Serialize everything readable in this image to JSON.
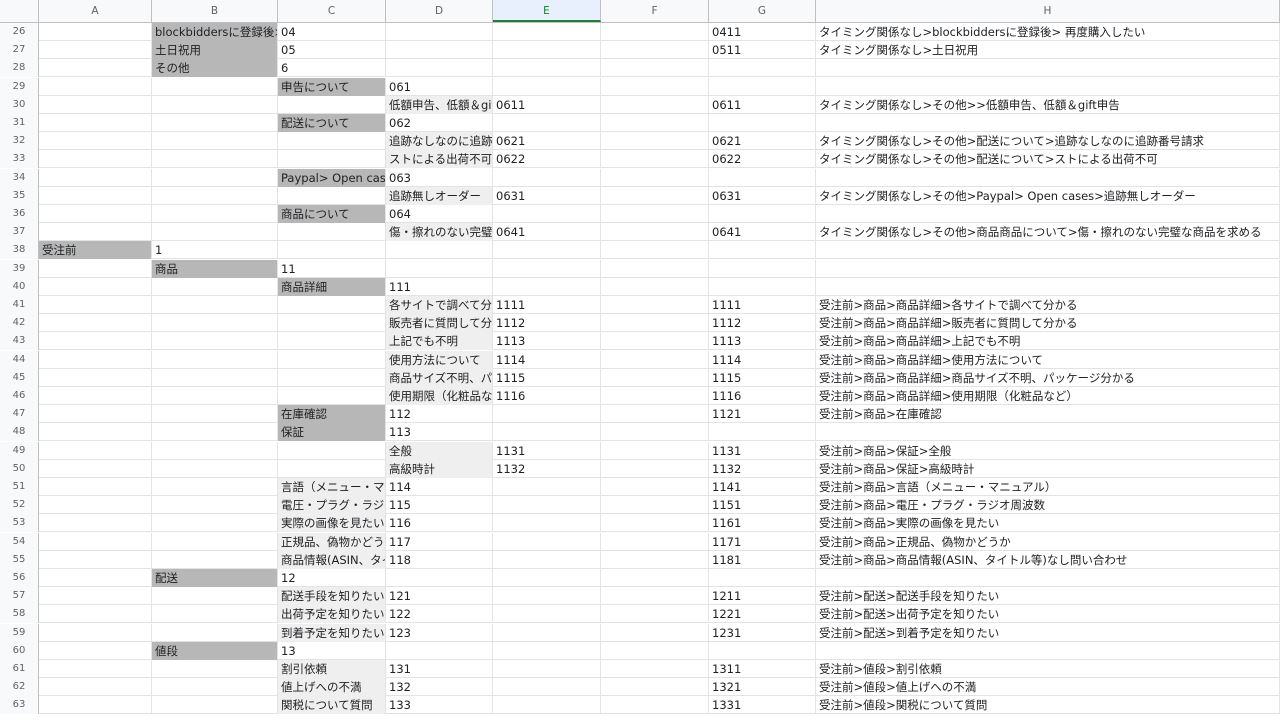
{
  "columns": [
    "A",
    "B",
    "C",
    "D",
    "E",
    "F",
    "G",
    "H"
  ],
  "selected_column": "E",
  "rows": [
    {
      "n": "26",
      "cells": {
        "B": {
          "t": "blockbiddersに登録後>",
          "bg": "gray"
        },
        "C": {
          "t": "04"
        },
        "G": {
          "t": "0411"
        },
        "H": {
          "t": "タイミング関係なし>blockbiddersに登録後> 再度購入したい"
        }
      }
    },
    {
      "n": "27",
      "cells": {
        "B": {
          "t": "土日祝用",
          "bg": "gray"
        },
        "C": {
          "t": "05"
        },
        "G": {
          "t": "0511"
        },
        "H": {
          "t": "タイミング関係なし>土日祝用"
        }
      }
    },
    {
      "n": "28",
      "cells": {
        "B": {
          "t": "その他",
          "bg": "gray"
        },
        "C": {
          "t": "6"
        }
      }
    },
    {
      "n": "29",
      "cells": {
        "C": {
          "t": "申告について",
          "bg": "gray"
        },
        "D": {
          "t": "061"
        }
      }
    },
    {
      "n": "30",
      "cells": {
        "D": {
          "t": "低額申告、低額＆gift",
          "bg": "lightgray"
        },
        "E": {
          "t": "0611"
        },
        "G": {
          "t": "0611"
        },
        "H": {
          "t": "タイミング関係なし>その他>>低額申告、低額＆gift申告"
        }
      }
    },
    {
      "n": "31",
      "cells": {
        "C": {
          "t": "配送について",
          "bg": "gray"
        },
        "D": {
          "t": "062"
        }
      }
    },
    {
      "n": "32",
      "cells": {
        "D": {
          "t": "追跡なしなのに追跡番号請求",
          "bg": "lightgray"
        },
        "E": {
          "t": "0621"
        },
        "G": {
          "t": "0621"
        },
        "H": {
          "t": "タイミング関係なし>その他>配送について>追跡なしなのに追跡番号請求"
        }
      }
    },
    {
      "n": "33",
      "cells": {
        "D": {
          "t": "ストによる出荷不可",
          "bg": "lightgray"
        },
        "E": {
          "t": "0622"
        },
        "G": {
          "t": "0622"
        },
        "H": {
          "t": "タイミング関係なし>その他>配送について>ストによる出荷不可"
        }
      }
    },
    {
      "n": "34",
      "cells": {
        "C": {
          "t": "Paypal> Open cases",
          "bg": "gray"
        },
        "D": {
          "t": "063"
        }
      }
    },
    {
      "n": "35",
      "cells": {
        "D": {
          "t": "追跡無しオーダー",
          "bg": "lightgray"
        },
        "E": {
          "t": "0631"
        },
        "G": {
          "t": "0631"
        },
        "H": {
          "t": "タイミング関係なし>その他>Paypal> Open cases>追跡無しオーダー"
        }
      }
    },
    {
      "n": "36",
      "cells": {
        "C": {
          "t": "商品について",
          "bg": "gray"
        },
        "D": {
          "t": "064"
        }
      }
    },
    {
      "n": "37",
      "cells": {
        "D": {
          "t": "傷・擦れのない完璧な商品を求める",
          "bg": "lightgray"
        },
        "E": {
          "t": "0641"
        },
        "G": {
          "t": "0641"
        },
        "H": {
          "t": "タイミング関係なし>その他>商品商品について>傷・擦れのない完璧な商品を求める"
        }
      }
    },
    {
      "n": "38",
      "cells": {
        "A": {
          "t": "受注前",
          "bg": "gray"
        },
        "B": {
          "t": "1"
        }
      }
    },
    {
      "n": "39",
      "cells": {
        "B": {
          "t": "商品",
          "bg": "gray"
        },
        "C": {
          "t": "11"
        }
      }
    },
    {
      "n": "40",
      "cells": {
        "C": {
          "t": "商品詳細",
          "bg": "gray"
        },
        "D": {
          "t": "111"
        }
      }
    },
    {
      "n": "41",
      "cells": {
        "D": {
          "t": "各サイトで調べて分かる",
          "bg": "lightgray"
        },
        "E": {
          "t": "1111"
        },
        "G": {
          "t": "1111"
        },
        "H": {
          "t": "受注前>商品>商品詳細>各サイトで調べて分かる"
        }
      }
    },
    {
      "n": "42",
      "cells": {
        "D": {
          "t": "販売者に質問して分かる",
          "bg": "lightgray"
        },
        "E": {
          "t": "1112"
        },
        "G": {
          "t": "1112"
        },
        "H": {
          "t": "受注前>商品>商品詳細>販売者に質問して分かる"
        }
      }
    },
    {
      "n": "43",
      "cells": {
        "D": {
          "t": "上記でも不明",
          "bg": "lightgray"
        },
        "E": {
          "t": "1113"
        },
        "G": {
          "t": "1113"
        },
        "H": {
          "t": "受注前>商品>商品詳細>上記でも不明"
        }
      }
    },
    {
      "n": "44",
      "cells": {
        "D": {
          "t": "使用方法について",
          "bg": "lightgray"
        },
        "E": {
          "t": "1114"
        },
        "G": {
          "t": "1114"
        },
        "H": {
          "t": "受注前>商品>商品詳細>使用方法について"
        }
      }
    },
    {
      "n": "45",
      "cells": {
        "D": {
          "t": "商品サイズ不明、パッケージ分かる",
          "bg": "lightgray"
        },
        "E": {
          "t": "1115"
        },
        "G": {
          "t": "1115"
        },
        "H": {
          "t": "受注前>商品>商品詳細>商品サイズ不明、パッケージ分かる"
        }
      }
    },
    {
      "n": "46",
      "cells": {
        "D": {
          "t": "使用期限（化粧品など）",
          "bg": "lightgray"
        },
        "E": {
          "t": "1116"
        },
        "G": {
          "t": "1116"
        },
        "H": {
          "t": "受注前>商品>商品詳細>使用期限（化粧品など）"
        }
      }
    },
    {
      "n": "47",
      "cells": {
        "C": {
          "t": "在庫確認",
          "bg": "gray"
        },
        "D": {
          "t": "112"
        },
        "G": {
          "t": "1121"
        },
        "H": {
          "t": "受注前>商品>在庫確認"
        }
      }
    },
    {
      "n": "48",
      "cells": {
        "C": {
          "t": "保証",
          "bg": "gray"
        },
        "D": {
          "t": "113"
        }
      }
    },
    {
      "n": "49",
      "cells": {
        "D": {
          "t": "全般",
          "bg": "lightgray"
        },
        "E": {
          "t": "1131"
        },
        "G": {
          "t": "1131"
        },
        "H": {
          "t": "受注前>商品>保証>全般"
        }
      }
    },
    {
      "n": "50",
      "cells": {
        "D": {
          "t": "高級時計",
          "bg": "lightgray"
        },
        "E": {
          "t": "1132"
        },
        "G": {
          "t": "1132"
        },
        "H": {
          "t": "受注前>商品>保証>高級時計"
        }
      }
    },
    {
      "n": "51",
      "cells": {
        "C": {
          "t": "言語（メニュー・マニュアル）",
          "bg": "lightgray"
        },
        "D": {
          "t": "114"
        },
        "G": {
          "t": "1141"
        },
        "H": {
          "t": "受注前>商品>言語（メニュー・マニュアル）"
        }
      }
    },
    {
      "n": "52",
      "cells": {
        "C": {
          "t": "電圧・プラグ・ラジオ周波数",
          "bg": "lightgray"
        },
        "D": {
          "t": "115"
        },
        "G": {
          "t": "1151"
        },
        "H": {
          "t": "受注前>商品>電圧・プラグ・ラジオ周波数"
        }
      }
    },
    {
      "n": "53",
      "cells": {
        "C": {
          "t": "実際の画像を見たい",
          "bg": "lightgray"
        },
        "D": {
          "t": "116"
        },
        "G": {
          "t": "1161"
        },
        "H": {
          "t": "受注前>商品>実際の画像を見たい"
        }
      }
    },
    {
      "n": "54",
      "cells": {
        "C": {
          "t": "正規品、偽物かどうか",
          "bg": "lightgray"
        },
        "D": {
          "t": "117"
        },
        "G": {
          "t": "1171"
        },
        "H": {
          "t": "受注前>商品>正規品、偽物かどうか"
        }
      }
    },
    {
      "n": "55",
      "cells": {
        "C": {
          "t": "商品情報(ASIN、タイトル等)なし",
          "bg": "lightgray"
        },
        "D": {
          "t": "118"
        },
        "G": {
          "t": "1181"
        },
        "H": {
          "t": "受注前>商品>商品情報(ASIN、タイトル等)なし問い合わせ"
        }
      }
    },
    {
      "n": "56",
      "cells": {
        "B": {
          "t": "配送",
          "bg": "gray"
        },
        "C": {
          "t": "12"
        }
      }
    },
    {
      "n": "57",
      "cells": {
        "C": {
          "t": "配送手段を知りたい",
          "bg": "lightgray"
        },
        "D": {
          "t": "121"
        },
        "G": {
          "t": "1211"
        },
        "H": {
          "t": "受注前>配送>配送手段を知りたい"
        }
      }
    },
    {
      "n": "58",
      "cells": {
        "C": {
          "t": "出荷予定を知りたい",
          "bg": "lightgray"
        },
        "D": {
          "t": "122"
        },
        "G": {
          "t": "1221"
        },
        "H": {
          "t": "受注前>配送>出荷予定を知りたい"
        }
      }
    },
    {
      "n": "59",
      "cells": {
        "C": {
          "t": "到着予定を知りたい",
          "bg": "lightgray"
        },
        "D": {
          "t": "123"
        },
        "G": {
          "t": "1231"
        },
        "H": {
          "t": "受注前>配送>到着予定を知りたい"
        }
      }
    },
    {
      "n": "60",
      "cells": {
        "B": {
          "t": "値段",
          "bg": "gray"
        },
        "C": {
          "t": "13"
        }
      }
    },
    {
      "n": "61",
      "cells": {
        "C": {
          "t": "割引依頼",
          "bg": "lightgray"
        },
        "D": {
          "t": "131"
        },
        "G": {
          "t": "1311"
        },
        "H": {
          "t": "受注前>値段>割引依頼"
        }
      }
    },
    {
      "n": "62",
      "cells": {
        "C": {
          "t": "値上げへの不満",
          "bg": "lightgray"
        },
        "D": {
          "t": "132"
        },
        "G": {
          "t": "1321"
        },
        "H": {
          "t": "受注前>値段>値上げへの不満"
        }
      }
    },
    {
      "n": "63",
      "cells": {
        "C": {
          "t": "関税について質問",
          "bg": "lightgray"
        },
        "D": {
          "t": "133"
        },
        "G": {
          "t": "1331"
        },
        "H": {
          "t": "受注前>値段>関税について質問"
        }
      }
    }
  ]
}
